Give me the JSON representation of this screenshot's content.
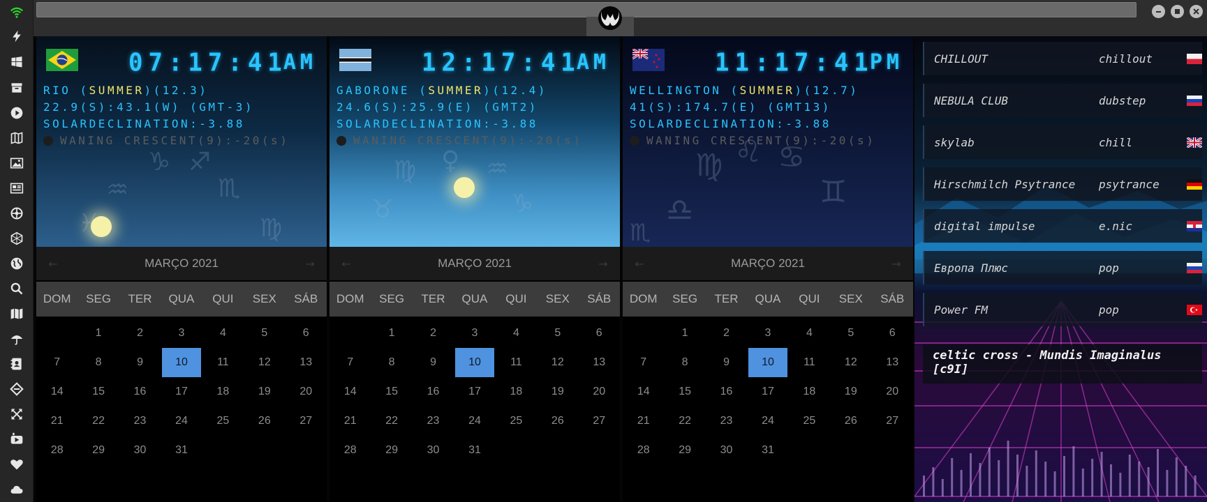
{
  "sidebar": {
    "icons": [
      "wifi-icon",
      "bolt-icon",
      "windows-icon",
      "archive-icon",
      "play-icon",
      "map-book-icon",
      "image-icon",
      "news-icon",
      "settings-wheel-icon",
      "hexagon-icon",
      "globe-icon",
      "search-icon",
      "map-icon",
      "umbrella-icon",
      "contacts-icon",
      "tag-icon",
      "expand-icon",
      "youtube-icon",
      "heart-icon",
      "cloud-icon"
    ],
    "accent": "#2bd82b"
  },
  "titlebar": {
    "emblem": "rebel-alliance-emblem"
  },
  "clocks": [
    {
      "flag": "brazil-flag",
      "time": "07:17:41",
      "ampm": "AM",
      "city": "RIO",
      "season": "SUMMER",
      "daylight": "(12.3)",
      "coords": "22.9(S):43.1(W) (GMT-3)",
      "solar": "SOLARDECLINATION:-3.88",
      "moon": "WANING CRESCENT(9):-20",
      "moon_suffix": "(s)",
      "calendar": {
        "title": "MARÇO 2021",
        "days": [
          "DOM",
          "SEG",
          "TER",
          "QUA",
          "QUI",
          "SEX",
          "SÁB"
        ]
      }
    },
    {
      "flag": "botswana-flag",
      "time": "12:17:41",
      "ampm": "AM",
      "city": "GABORONE",
      "season": "SUMMER",
      "daylight": "(12.4)",
      "coords": "24.6(S):25.9(E) (GMT2)",
      "solar": "SOLARDECLINATION:-3.88",
      "moon": "WANING CRESCENT(9):-20",
      "moon_suffix": "(s)",
      "calendar": {
        "title": "MARÇO 2021",
        "days": [
          "DOM",
          "SEG",
          "TER",
          "QUA",
          "QUI",
          "SEX",
          "SÁB"
        ]
      }
    },
    {
      "flag": "new-zealand-flag",
      "time": "11:17:41",
      "ampm": "PM",
      "city": "WELLINGTON",
      "season": "SUMMER",
      "daylight": "(12.7)",
      "coords": "41(S):174.7(E) (GMT13)",
      "solar": "SOLARDECLINATION:-3.88",
      "moon": "WANING CRESCENT(9):-20",
      "moon_suffix": "(s)",
      "calendar": {
        "title": "MARÇO 2021",
        "days": [
          "DOM",
          "SEG",
          "TER",
          "QUA",
          "QUI",
          "SEX",
          "SÁB"
        ]
      }
    }
  ],
  "calendar_weeks": [
    [
      "",
      "1",
      "2",
      "3",
      "4",
      "5",
      "6"
    ],
    [
      "7",
      "8",
      "9",
      "10",
      "11",
      "12",
      "13"
    ],
    [
      "14",
      "15",
      "16",
      "17",
      "18",
      "19",
      "20"
    ],
    [
      "21",
      "22",
      "23",
      "24",
      "25",
      "26",
      "27"
    ],
    [
      "28",
      "29",
      "30",
      "31",
      "",
      "",
      ""
    ]
  ],
  "calendar_today": "10",
  "radio": {
    "stations": [
      {
        "name": "CHILLOUT",
        "genre": "chillout",
        "flag": "poland-flag"
      },
      {
        "name": "NEBULA CLUB",
        "genre": "dubstep",
        "flag": "russia-flag"
      },
      {
        "name": "skylab",
        "genre": "chill",
        "flag": "uk-flag"
      },
      {
        "name": "Hirschmilch Psytrance",
        "genre": "psytrance",
        "flag": "germany-flag"
      },
      {
        "name": "digital impulse",
        "genre": "e.nic",
        "flag": "croatia-flag"
      },
      {
        "name": "Европа Плюс",
        "genre": "pop",
        "flag": "russia-flag"
      },
      {
        "name": "Power FM",
        "genre": "pop",
        "flag": "turkey-flag"
      }
    ],
    "now_playing": "celtic cross - Mundis Imaginalus [c9I]"
  },
  "colors": {
    "digits": "#29c4ff",
    "season": "#f0e56a",
    "today": "#4f92e0"
  }
}
